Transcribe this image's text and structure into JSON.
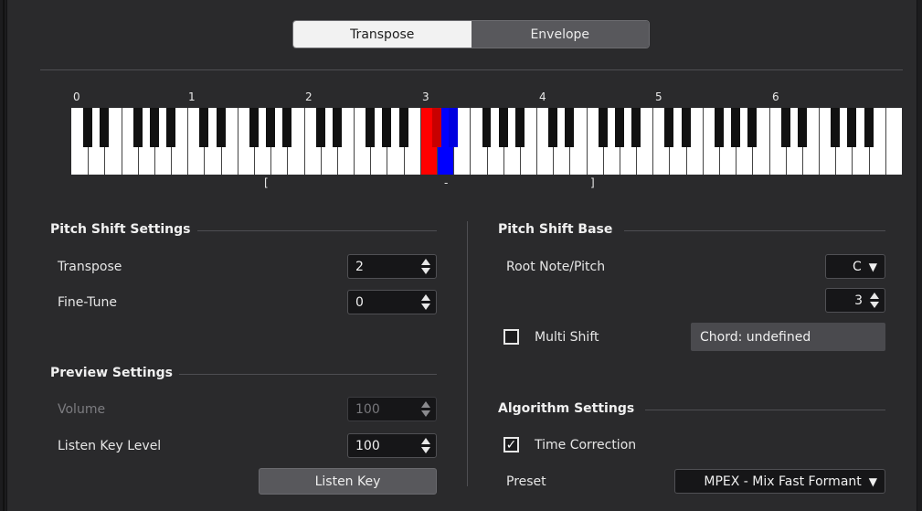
{
  "tabs": [
    {
      "label": "Transpose",
      "active": true
    },
    {
      "label": "Envelope",
      "active": false
    }
  ],
  "keyboard": {
    "octave_labels": [
      "0",
      "1",
      "2",
      "3",
      "4",
      "5",
      "6"
    ],
    "range_start_marker": "[",
    "root_marker": "-",
    "range_end_marker": "]",
    "highlight_root_color": "#ff0000",
    "highlight_target_color": "#0000ff"
  },
  "pitch_shift_settings": {
    "title": "Pitch Shift Settings",
    "transpose_label": "Transpose",
    "transpose_value": "2",
    "finetune_label": "Fine-Tune",
    "finetune_value": "0"
  },
  "preview_settings": {
    "title": "Preview Settings",
    "volume_label": "Volume",
    "volume_value": "100",
    "listen_key_level_label": "Listen Key Level",
    "listen_key_level_value": "100",
    "listen_key_button": "Listen Key"
  },
  "pitch_shift_base": {
    "title": "Pitch Shift Base",
    "root_note_label": "Root Note/Pitch",
    "root_note_value": "C",
    "octave_value": "3",
    "multi_shift_label": "Multi Shift",
    "multi_shift_checked": false,
    "chord_text": "Chord: undefined"
  },
  "algorithm_settings": {
    "title": "Algorithm Settings",
    "time_correction_label": "Time Correction",
    "time_correction_checked": true,
    "check_glyph": "✓",
    "preset_label": "Preset",
    "preset_value": "MPEX - Mix Fast Formant"
  },
  "icons": {
    "dropdown_caret": "▼"
  }
}
